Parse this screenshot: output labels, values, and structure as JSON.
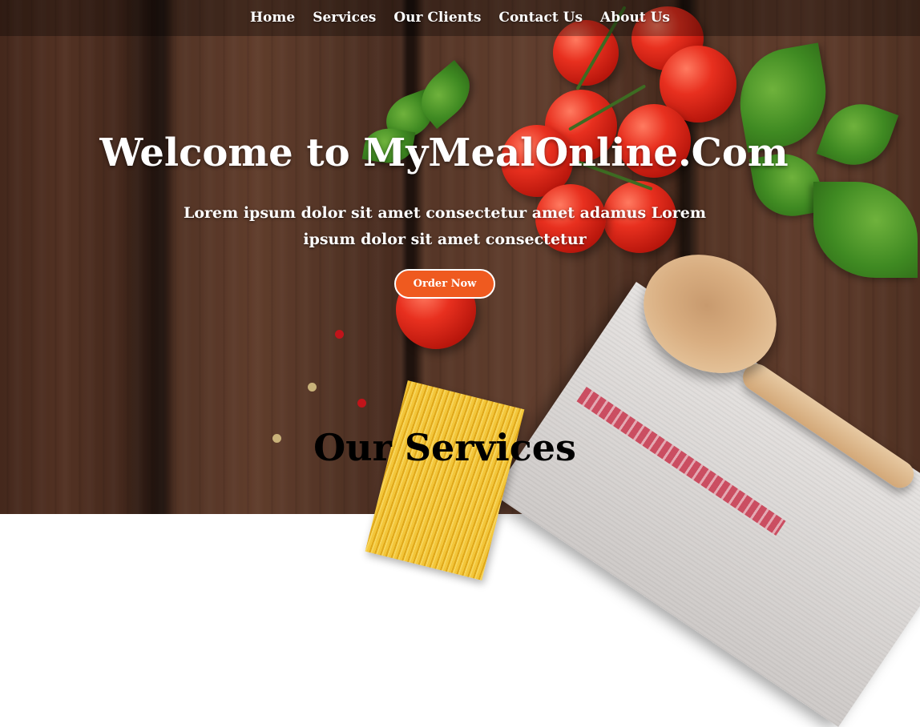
{
  "nav": {
    "items": [
      {
        "label": "Home"
      },
      {
        "label": "Services"
      },
      {
        "label": "Our Clients"
      },
      {
        "label": "Contact Us"
      },
      {
        "label": "About Us"
      }
    ]
  },
  "hero": {
    "title": "Welcome to MyMealOnline.Com",
    "text": "Lorem ipsum dolor sit amet consectetur amet adamus Lorem ipsum dolor sit amet consectetur",
    "button_label": "Order Now"
  },
  "services": {
    "title": "Our Services"
  },
  "colors": {
    "accent": "#ef5a1f",
    "nav_text": "#ffffff",
    "heading_dark": "#000000"
  }
}
